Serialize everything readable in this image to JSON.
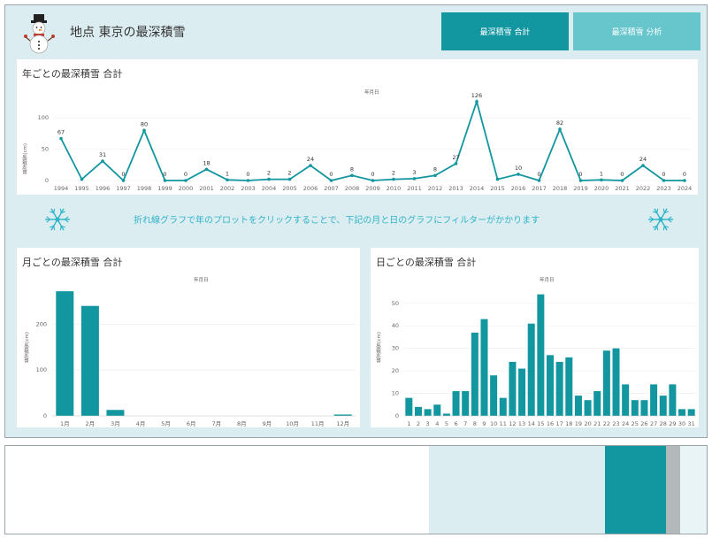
{
  "header": {
    "title": "地点 東京の最深積雪",
    "tabs": [
      {
        "label": "最深積雪 合計"
      },
      {
        "label": "最深積雪 分析"
      }
    ]
  },
  "colors": {
    "accent": "#12969f",
    "accent_light": "#66c6cc",
    "panel_bg": "#dcedf1",
    "message": "#2fb4c7"
  },
  "filter_message": "折れ線グラフで年のプロットをクリックすることで、下記の月と日のグラフにフィルターがかかります",
  "yearly": {
    "title": "年ごとの最深積雪 合計",
    "axis_caption": "年月日",
    "ylabel": "最深積雪(cm)",
    "yticks": [
      "0",
      "50",
      "100"
    ]
  },
  "monthly": {
    "title": "月ごとの最深積雪 合計",
    "axis_caption": "年月日",
    "ylabel": "最深積雪(cm)",
    "yticks": [
      "0",
      "100",
      "200"
    ]
  },
  "daily": {
    "title": "日ごとの最深積雪 合計",
    "axis_caption": "年月日",
    "ylabel": "最深積雪(cm)",
    "yticks": [
      "0",
      "10",
      "20",
      "30",
      "40",
      "50"
    ]
  },
  "chart_data": [
    {
      "type": "line",
      "title": "年ごとの最深積雪 合計",
      "xlabel": "年月日",
      "ylabel": "最深積雪(cm)",
      "x": [
        "1994",
        "1995",
        "1996",
        "1997",
        "1998",
        "1999",
        "2000",
        "2001",
        "2002",
        "2003",
        "2004",
        "2005",
        "2006",
        "2007",
        "2008",
        "2009",
        "2010",
        "2011",
        "2012",
        "2013",
        "2014",
        "2015",
        "2016",
        "2017",
        "2018",
        "2019",
        "2020",
        "2021",
        "2022",
        "2023",
        "2024"
      ],
      "values": [
        67,
        2,
        31,
        0,
        80,
        0,
        0,
        18,
        1,
        0,
        2,
        2,
        24,
        0,
        8,
        0,
        2,
        3,
        8,
        27,
        126,
        2,
        10,
        0,
        82,
        0,
        1,
        0,
        24,
        0,
        0
      ],
      "labels": [
        "67",
        "",
        "31",
        "0",
        "80",
        "0",
        "0",
        "18",
        "1",
        "0",
        "2",
        "2",
        "24",
        "0",
        "8",
        "0",
        "2",
        "3",
        "8",
        "27",
        "126",
        "",
        "10",
        "0",
        "82",
        "0",
        "1",
        "0",
        "24",
        "0",
        "0"
      ],
      "ylim": [
        0,
        130
      ]
    },
    {
      "type": "bar",
      "title": "月ごとの最深積雪 合計",
      "xlabel": "年月日",
      "ylabel": "最深積雪(cm)",
      "categories": [
        "1月",
        "2月",
        "3月",
        "4月",
        "5月",
        "6月",
        "7月",
        "8月",
        "9月",
        "10月",
        "11月",
        "12月"
      ],
      "values": [
        272,
        240,
        13,
        0,
        0,
        0,
        0,
        0,
        0,
        0,
        0,
        3
      ],
      "ylim": [
        0,
        280
      ]
    },
    {
      "type": "bar",
      "title": "日ごとの最深積雪 合計",
      "xlabel": "年月日",
      "ylabel": "最深積雪(cm)",
      "categories": [
        "1",
        "2",
        "3",
        "4",
        "5",
        "6",
        "7",
        "8",
        "9",
        "10",
        "11",
        "12",
        "13",
        "14",
        "15",
        "16",
        "17",
        "18",
        "19",
        "20",
        "21",
        "22",
        "23",
        "24",
        "25",
        "26",
        "27",
        "28",
        "29",
        "30",
        "31"
      ],
      "values": [
        8,
        4,
        3,
        5,
        1,
        11,
        11,
        37,
        43,
        18,
        8,
        24,
        21,
        41,
        54,
        27,
        24,
        26,
        9,
        7,
        11,
        29,
        30,
        14,
        7,
        7,
        14,
        9,
        14,
        3,
        3
      ],
      "ylim": [
        0,
        57
      ]
    }
  ]
}
